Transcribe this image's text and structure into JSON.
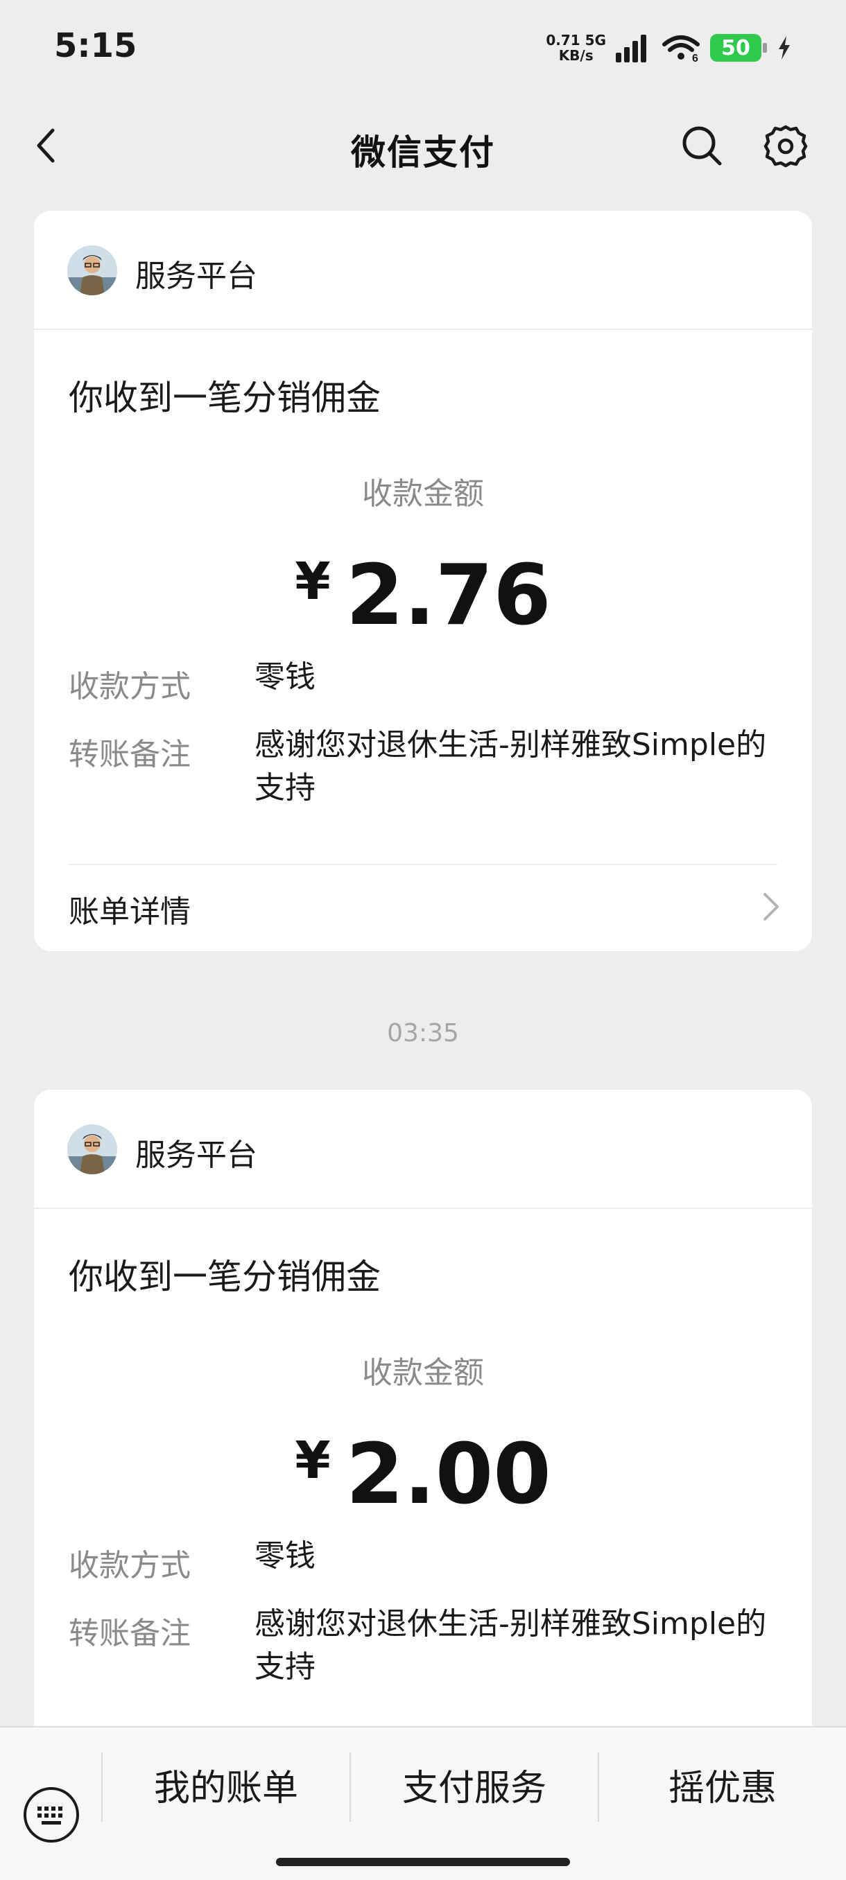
{
  "status_bar": {
    "time": "5:15",
    "net_speed_value": "0.71",
    "net_speed_unit": "KB/s",
    "network_type": "5G",
    "wifi_badge": "6",
    "battery_level": "50",
    "battery_color": "#2fc94e"
  },
  "nav": {
    "title": "微信支付",
    "icons": [
      "back-icon",
      "search-icon",
      "gear-icon"
    ]
  },
  "messages": [
    {
      "platform": "服务平台",
      "title": "你收到一笔分销佣金",
      "amount_label": "收款金额",
      "currency": "¥",
      "amount": "2.76",
      "method_label": "收款方式",
      "method_value": "零钱",
      "note_label": "转账备注",
      "note_value": "感谢您对退休生活-别样雅致Simple的支持",
      "detail_label": "账单详情"
    },
    {
      "platform": "服务平台",
      "title": "你收到一笔分销佣金",
      "amount_label": "收款金额",
      "currency": "¥",
      "amount": "2.00",
      "method_label": "收款方式",
      "method_value": "零钱",
      "note_label": "转账备注",
      "note_value": "感谢您对退休生活-别样雅致Simple的支持"
    }
  ],
  "timestamp": "03:35",
  "bottom_menu": {
    "items": [
      "我的账单",
      "支付服务",
      "摇优惠"
    ]
  }
}
